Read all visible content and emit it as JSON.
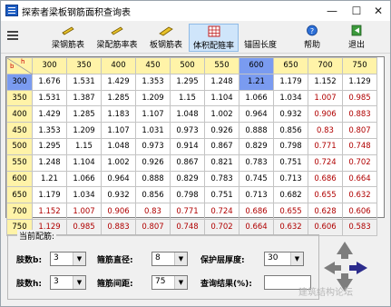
{
  "window": {
    "title": "探索者梁板钢筋面积查询表",
    "min_glyph": "—",
    "max_glyph": "☐",
    "close_glyph": "✕"
  },
  "toolbar": {
    "items": [
      {
        "label": "梁钢筋表",
        "icon": "beam-rebar-icon"
      },
      {
        "label": "梁配筋率表",
        "icon": "beam-ratio-icon"
      },
      {
        "label": "板钢筋表",
        "icon": "slab-rebar-icon"
      },
      {
        "label": "体积配箍率",
        "icon": "stirrup-ratio-grid-icon",
        "active": true
      },
      {
        "label": "锚固长度",
        "icon": "anchorage-icon"
      },
      {
        "label": "帮助",
        "icon": "help-icon"
      },
      {
        "label": "退出",
        "icon": "exit-icon"
      }
    ]
  },
  "grid": {
    "corner_b": "b",
    "corner_h": "h",
    "columns": [
      "300",
      "350",
      "400",
      "450",
      "500",
      "550",
      "600",
      "650",
      "700",
      "750"
    ],
    "selected_column_index": 6,
    "selected_row_index": 0,
    "rows": [
      {
        "head": "300",
        "cells": [
          "1.676",
          "1.531",
          "1.429",
          "1.353",
          "1.295",
          "1.248",
          "1.21",
          "1.179",
          "1.152",
          "1.129"
        ]
      },
      {
        "head": "350",
        "cells": [
          "1.531",
          "1.387",
          "1.285",
          "1.209",
          "1.15",
          "1.104",
          "1.066",
          "1.034",
          "1.007",
          "0.985"
        ]
      },
      {
        "head": "400",
        "cells": [
          "1.429",
          "1.285",
          "1.183",
          "1.107",
          "1.048",
          "1.002",
          "0.964",
          "0.932",
          "0.906",
          "0.883"
        ]
      },
      {
        "head": "450",
        "cells": [
          "1.353",
          "1.209",
          "1.107",
          "1.031",
          "0.973",
          "0.926",
          "0.888",
          "0.856",
          "0.83",
          "0.807"
        ]
      },
      {
        "head": "500",
        "cells": [
          "1.295",
          "1.15",
          "1.048",
          "0.973",
          "0.914",
          "0.867",
          "0.829",
          "0.798",
          "0.771",
          "0.748"
        ]
      },
      {
        "head": "550",
        "cells": [
          "1.248",
          "1.104",
          "1.002",
          "0.926",
          "0.867",
          "0.821",
          "0.783",
          "0.751",
          "0.724",
          "0.702"
        ]
      },
      {
        "head": "600",
        "cells": [
          "1.21",
          "1.066",
          "0.964",
          "0.888",
          "0.829",
          "0.783",
          "0.745",
          "0.713",
          "0.686",
          "0.664"
        ]
      },
      {
        "head": "650",
        "cells": [
          "1.179",
          "1.034",
          "0.932",
          "0.856",
          "0.798",
          "0.751",
          "0.713",
          "0.682",
          "0.655",
          "0.632"
        ]
      },
      {
        "head": "700",
        "cells": [
          "1.152",
          "1.007",
          "0.906",
          "0.83",
          "0.771",
          "0.724",
          "0.686",
          "0.655",
          "0.628",
          "0.606"
        ]
      },
      {
        "head": "750",
        "cells": [
          "1.129",
          "0.985",
          "0.883",
          "0.807",
          "0.748",
          "0.702",
          "0.664",
          "0.632",
          "0.606",
          "0.583"
        ]
      }
    ],
    "red_cells": [
      [
        1,
        8
      ],
      [
        1,
        9
      ],
      [
        2,
        8
      ],
      [
        2,
        9
      ],
      [
        3,
        8
      ],
      [
        3,
        9
      ],
      [
        4,
        8
      ],
      [
        4,
        9
      ],
      [
        5,
        8
      ],
      [
        5,
        9
      ],
      [
        6,
        8
      ],
      [
        6,
        9
      ],
      [
        7,
        8
      ],
      [
        7,
        9
      ],
      [
        8,
        8
      ],
      [
        8,
        9
      ],
      [
        8,
        0
      ],
      [
        8,
        1
      ],
      [
        8,
        2
      ],
      [
        8,
        3
      ],
      [
        8,
        4
      ],
      [
        8,
        5
      ],
      [
        8,
        6
      ],
      [
        8,
        7
      ],
      [
        9,
        0
      ],
      [
        9,
        1
      ],
      [
        9,
        2
      ],
      [
        9,
        3
      ],
      [
        9,
        4
      ],
      [
        9,
        5
      ],
      [
        9,
        6
      ],
      [
        9,
        7
      ],
      [
        9,
        8
      ],
      [
        9,
        9
      ]
    ]
  },
  "config": {
    "group_title": "当前配筋:",
    "legs_b_label": "肢数b:",
    "legs_b_value": "3",
    "legs_h_label": "肢数h:",
    "legs_h_value": "3",
    "stirrup_dia_label": "箍筋直径:",
    "stirrup_dia_value": "8",
    "stirrup_spacing_label": "箍筋间距:",
    "stirrup_spacing_value": "75",
    "cover_label": "保护层厚度:",
    "cover_value": "30",
    "result_label": "查询结果(%):",
    "result_value": ""
  },
  "watermark": "建筑结构论坛"
}
